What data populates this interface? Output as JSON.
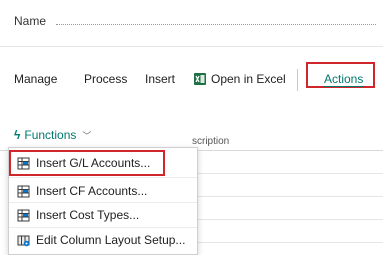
{
  "field": {
    "label": "Name"
  },
  "menubar": {
    "items": [
      {
        "label": "Manage"
      },
      {
        "label": "Process"
      },
      {
        "label": "Insert"
      },
      {
        "label": "Open in Excel"
      }
    ],
    "actions_label": "Actions"
  },
  "functions": {
    "label": "Functions"
  },
  "grid": {
    "column_header_fragment": "scription"
  },
  "dropdown": {
    "items": [
      {
        "label": "Insert G/L Accounts...",
        "icon": "insert-rows-icon"
      },
      {
        "label": "Insert CF Accounts...",
        "icon": "insert-rows-icon"
      },
      {
        "label": "Insert Cost Types...",
        "icon": "insert-rows-icon"
      },
      {
        "label": "Edit Column Layout Setup...",
        "icon": "column-layout-icon"
      }
    ]
  },
  "colors": {
    "accent": "#00786f",
    "highlight": "#d0262c",
    "excel": "#1e7145"
  }
}
